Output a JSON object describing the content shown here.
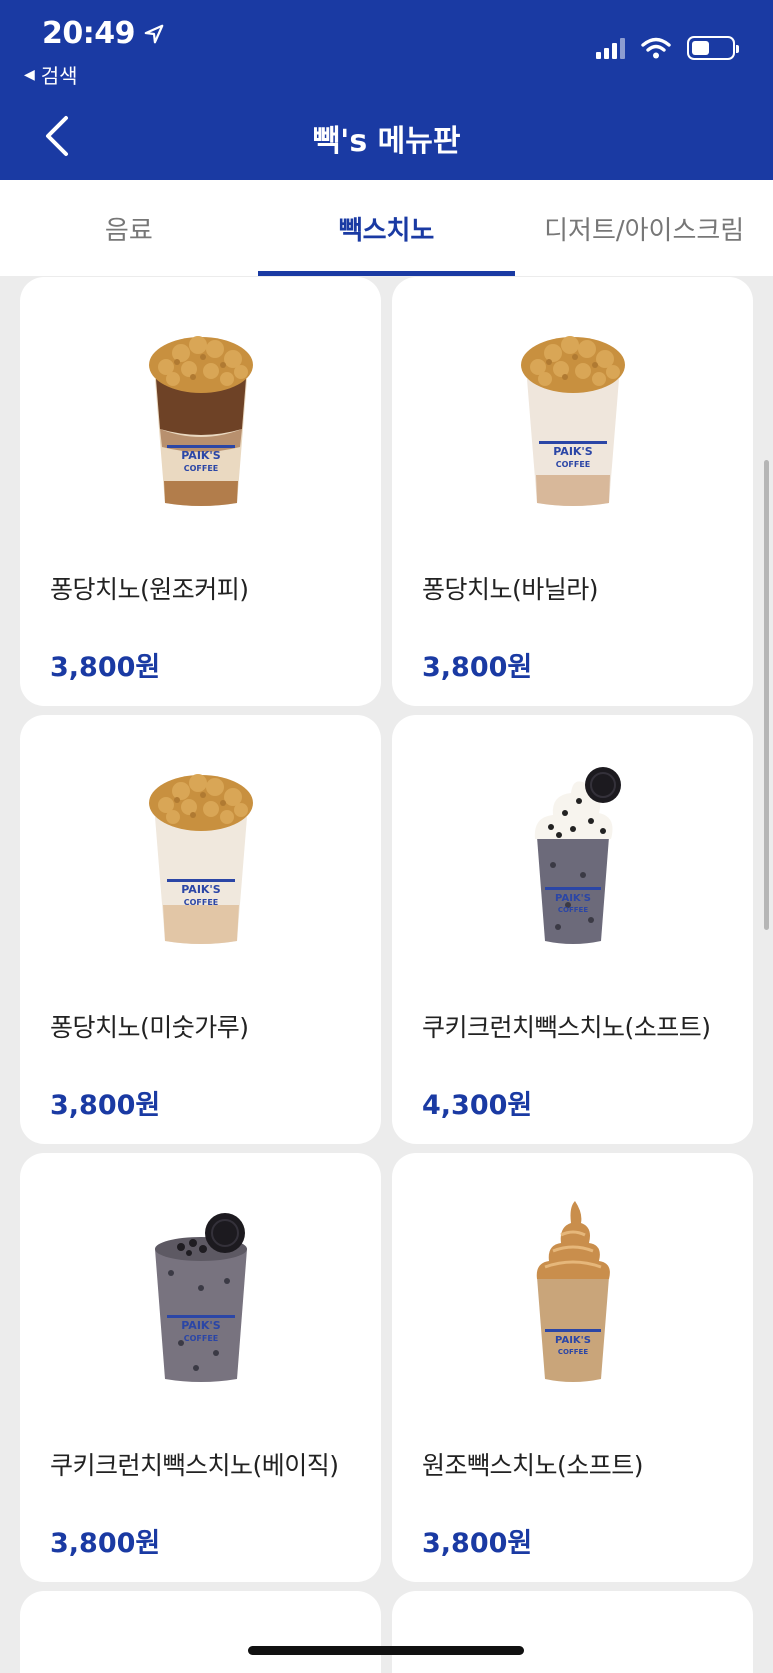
{
  "status_bar": {
    "time": "20:49",
    "back_app": "검색",
    "battery_level": 0.44
  },
  "nav": {
    "title": "빽's 메뉴판"
  },
  "tabs": [
    {
      "label": "음료"
    },
    {
      "label": "빽스치노"
    },
    {
      "label": "디저트/아이스크림"
    }
  ],
  "active_tab": 1,
  "menu": [
    {
      "name": "퐁당치노(원조커피)",
      "price": "3,800원",
      "image": "pongdang-coffee-drink"
    },
    {
      "name": "퐁당치노(바닐라)",
      "price": "3,800원",
      "image": "pongdang-vanilla-drink"
    },
    {
      "name": "퐁당치노(미숫가루)",
      "price": "3,800원",
      "image": "pongdang-misutgaru-drink"
    },
    {
      "name": "쿠키크런치빽스치노(소프트)",
      "price": "4,300원",
      "image": "cookie-crunch-soft-drink"
    },
    {
      "name": "쿠키크런치빽스치노(베이직)",
      "price": "3,800원",
      "image": "cookie-crunch-basic-drink"
    },
    {
      "name": "원조빽스치노(소프트)",
      "price": "3,800원",
      "image": "original-soft-drink"
    }
  ],
  "colors": {
    "brand": "#1a3aa3",
    "background": "#ececec",
    "card": "#ffffff"
  },
  "cup_logo_text": [
    "PAIK'S",
    "COFFEE"
  ]
}
